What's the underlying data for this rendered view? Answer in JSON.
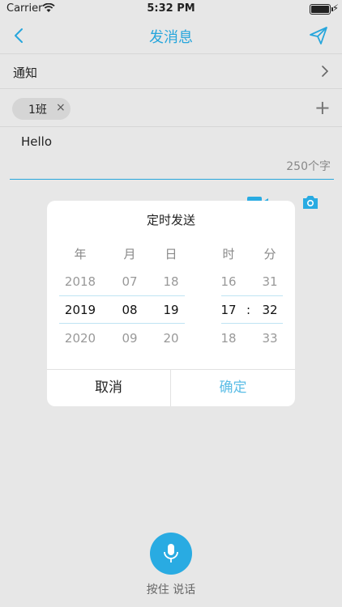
{
  "status_bar": {
    "carrier": "Carrier",
    "time": "5:32 PM"
  },
  "nav": {
    "title": "发消息"
  },
  "notice": {
    "label": "通知"
  },
  "recipients": {
    "chip_label": "1班",
    "chip_remove": "×",
    "add": "+"
  },
  "message": {
    "text": "Hello",
    "counter": "250个字"
  },
  "dialog": {
    "title": "定时发送",
    "headers": [
      "年",
      "月",
      "日",
      "时",
      "分"
    ],
    "rows": {
      "above": [
        "2018",
        "07",
        "18",
        "16",
        "31"
      ],
      "selected": [
        "2019",
        "08",
        "19",
        "17",
        "32"
      ],
      "below": [
        "2020",
        "09",
        "20",
        "18",
        "33"
      ]
    },
    "time_separator": ":",
    "cancel": "取消",
    "confirm": "确定"
  },
  "voice": {
    "label": "按住 说话"
  },
  "colors": {
    "accent": "#27a6dc",
    "background": "#e7e7e7",
    "confirm": "#5bbde6"
  }
}
